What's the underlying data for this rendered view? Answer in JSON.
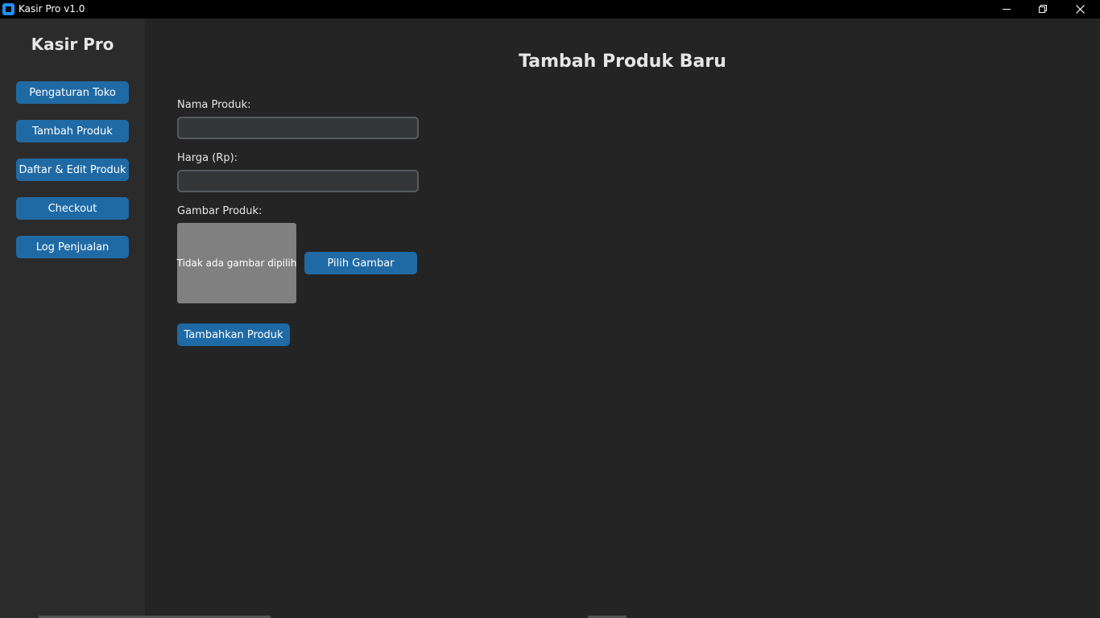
{
  "window": {
    "title": "Kasir Pro v1.0"
  },
  "sidebar": {
    "title": "Kasir Pro",
    "items": [
      {
        "label": "Pengaturan Toko"
      },
      {
        "label": "Tambah Produk"
      },
      {
        "label": "Daftar & Edit Produk"
      },
      {
        "label": "Checkout"
      },
      {
        "label": "Log Penjualan"
      }
    ]
  },
  "main": {
    "title": "Tambah Produk Baru",
    "fields": {
      "name_label": "Nama Produk:",
      "name_value": "",
      "price_label": "Harga (Rp):",
      "price_value": "",
      "image_label": "Gambar Produk:"
    },
    "image_placeholder": "Tidak ada gambar dipilih",
    "choose_image_label": "Pilih Gambar",
    "submit_label": "Tambahkan Produk"
  },
  "colors": {
    "accent": "#1f6aa5",
    "background": "#242424",
    "sidebar": "#2b2b2b",
    "input_bg": "#343638",
    "input_border": "#565b5e",
    "preview_bg": "#808080"
  },
  "icons": {
    "app": "app-logo-icon",
    "minimize": "minimize-icon",
    "maximize": "restore-icon",
    "close": "close-icon"
  }
}
